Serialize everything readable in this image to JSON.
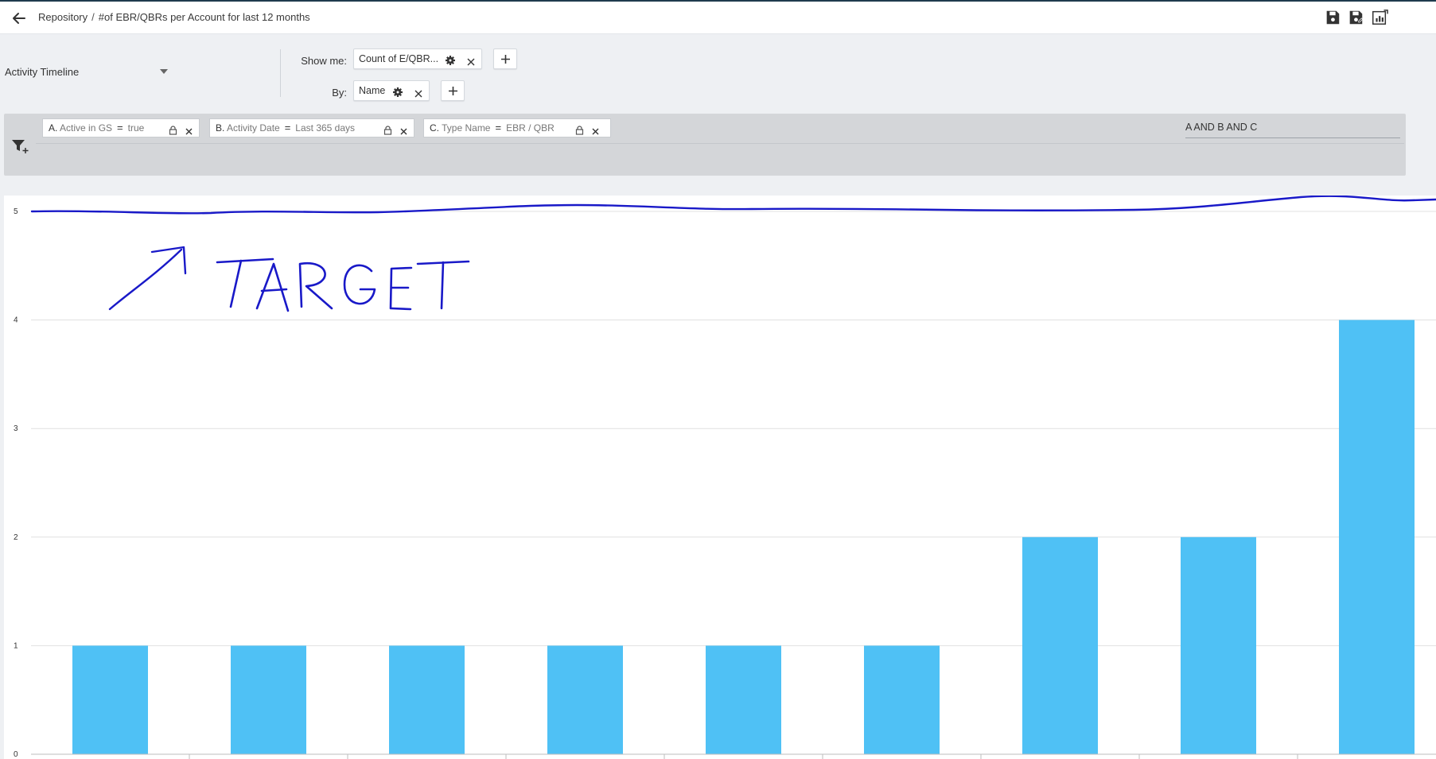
{
  "header": {
    "breadcrumb_root": "Repository",
    "separator": "/",
    "report_title": "#of EBR/QBRs per Account for last 12 months",
    "icons": [
      "arrow-left-icon",
      "save-icon",
      "save-as-icon",
      "chart-export-icon"
    ]
  },
  "config": {
    "source_label": "Activity Timeline",
    "show_me_label": "Show me:",
    "show_me_value": "Count of E/QBR...",
    "by_label": "By:",
    "by_value": "Name"
  },
  "filters": {
    "items": [
      {
        "letter": "A.",
        "field": "Active in GS",
        "operator": "=",
        "value": "true"
      },
      {
        "letter": "B.",
        "field": "Activity Date",
        "operator": "=",
        "value": "Last 365 days"
      },
      {
        "letter": "C.",
        "field": "Type Name",
        "operator": "=",
        "value": "EBR / QBR"
      }
    ],
    "logic": "A AND B AND C"
  },
  "annotation": {
    "text": "TARGET",
    "target_value": 5,
    "ink_color": "#1919c8"
  },
  "chart_data": {
    "type": "bar",
    "categories": [
      "",
      "",
      "",
      "",
      "",
      "",
      "",
      "",
      ""
    ],
    "series": [
      {
        "values": [
          1,
          1,
          1,
          1,
          1,
          1,
          2,
          2,
          4
        ]
      }
    ],
    "y_ticks": [
      "0",
      "1",
      "2",
      "3",
      "4",
      "5"
    ],
    "ylim": [
      0,
      5
    ],
    "grid": true,
    "bar_color": "#4fc1f5",
    "title": "",
    "xlabel": "",
    "ylabel": ""
  }
}
